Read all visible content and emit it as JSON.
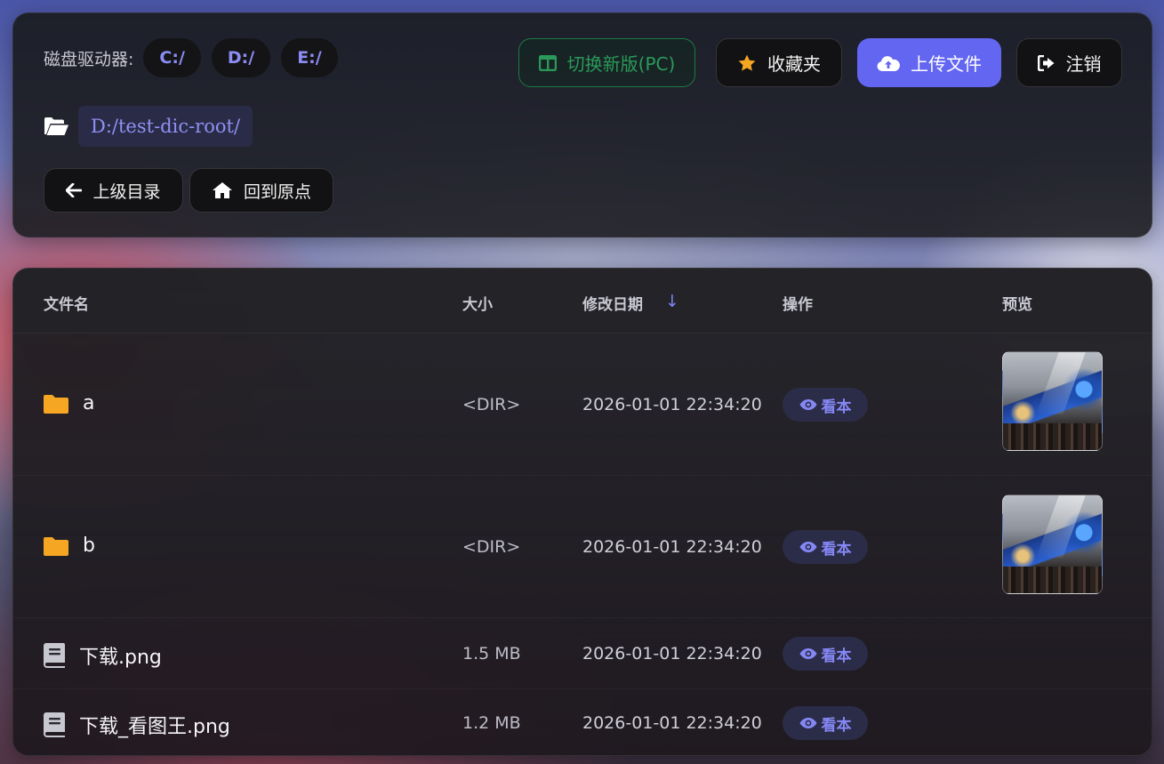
{
  "header": {
    "drives_label": "磁盘驱动器:",
    "drives": [
      "C:/",
      "D:/",
      "E:/"
    ],
    "switch_label": "切换新版(PC)",
    "favorites_label": "收藏夹",
    "upload_label": "上传文件",
    "logout_label": "注销",
    "current_path": "D:/test-dic-root/",
    "parent_dir_label": "上级目录",
    "home_label": "回到原点"
  },
  "table": {
    "columns": {
      "name": "文件名",
      "size": "大小",
      "modified": "修改日期",
      "sort_indicator": "↓",
      "actions": "操作",
      "preview": "预览"
    },
    "rows": [
      {
        "name": "a",
        "size": "<DIR>",
        "modified": "2026-01-01 22:34:20",
        "action": "看本",
        "type": "folder",
        "has_preview": true
      },
      {
        "name": "b",
        "size": "<DIR>",
        "modified": "2026-01-01 22:34:20",
        "action": "看本",
        "type": "folder",
        "has_preview": true
      },
      {
        "name": "下载.png",
        "size": "1.5 MB",
        "modified": "2026-01-01 22:34:20",
        "action": "看本",
        "type": "file",
        "has_preview": false
      },
      {
        "name": "下载_看图王.png",
        "size": "1.2 MB",
        "modified": "2026-01-01 22:34:20",
        "action": "看本",
        "type": "file",
        "has_preview": false
      }
    ]
  },
  "colors": {
    "accent": "#6366f1",
    "accent_text": "#8b8cf4",
    "switch_green": "#2a9a5a",
    "folder_yellow": "#f5a623",
    "star_orange": "#f5a623"
  }
}
